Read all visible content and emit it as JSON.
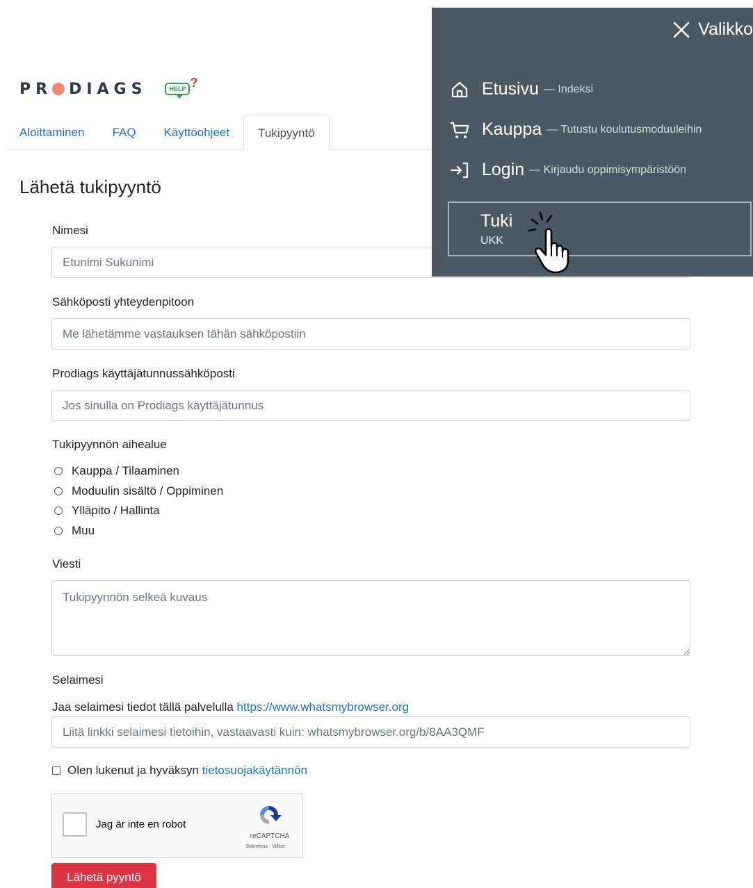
{
  "logo": {
    "text_before": "PR",
    "text_after": "DIAGS",
    "help_label": "HELP",
    "help_mark": "?"
  },
  "tabs": [
    {
      "label": "Aloittaminen",
      "active": false
    },
    {
      "label": "FAQ",
      "active": false
    },
    {
      "label": "Käyttöohjeet",
      "active": false
    },
    {
      "label": "Tukipyyntö",
      "active": true
    }
  ],
  "page": {
    "title": "Lähetä tukipyyntö"
  },
  "form": {
    "name": {
      "label": "Nimesi",
      "placeholder": "Etunimi Sukunimi"
    },
    "email": {
      "label": "Sähköposti yhteydenpitoon",
      "placeholder": "Me lähetämme vastauksen tähän sähköpostiin"
    },
    "account_email": {
      "label": "Prodiags käyttäjätunnussähköposti",
      "placeholder": "Jos sinulla on Prodiags käyttäjätunnus"
    },
    "topic": {
      "label": "Tukipyynnön aihealue",
      "options": [
        "Kauppa / Tilaaminen",
        "Moduulin sisältö / Oppiminen",
        "Ylläpito / Hallinta",
        "Muu"
      ]
    },
    "message": {
      "label": "Viesti",
      "placeholder": "Tukipyynnön selkeä kuvaus"
    },
    "browser": {
      "label": "Selaimesi",
      "hint": "Jaa selaimesi tiedot tällä palvelulla",
      "link": "https://www.whatsmybrowser.org",
      "placeholder": "Liitä linkki selaimesi tietoihin, vastaavasti kuin: whatsmybrowser.org/b/8AA3QMF"
    },
    "consent": {
      "text": "Olen lukenut ja hyväksyn",
      "link": "tietosuojakäytännön"
    },
    "recaptcha": {
      "label": "Jag är inte en robot",
      "brand": "reCAPTCHA",
      "terms": "Sekretess - Villkor"
    },
    "submit_label": "Lähetä pyyntö"
  },
  "menu": {
    "close_label": "Valikko",
    "items": [
      {
        "title": "Etusivu",
        "desc": "— Indeksi",
        "icon": "home-icon"
      },
      {
        "title": "Kauppa",
        "desc": "— Tutustu koulutusmoduuleihin",
        "icon": "cart-icon"
      },
      {
        "title": "Login",
        "desc": "— Kirjaudu oppimisympäristöön",
        "icon": "login-icon"
      }
    ],
    "active": {
      "title": "Tuki",
      "sub": "UKK"
    }
  },
  "colors": {
    "menu_bg": "#4a5963",
    "link": "#1a73c8",
    "submit": "#dc3545",
    "help_green": "#2fa34f",
    "logo_dot": "#f08a6a"
  }
}
